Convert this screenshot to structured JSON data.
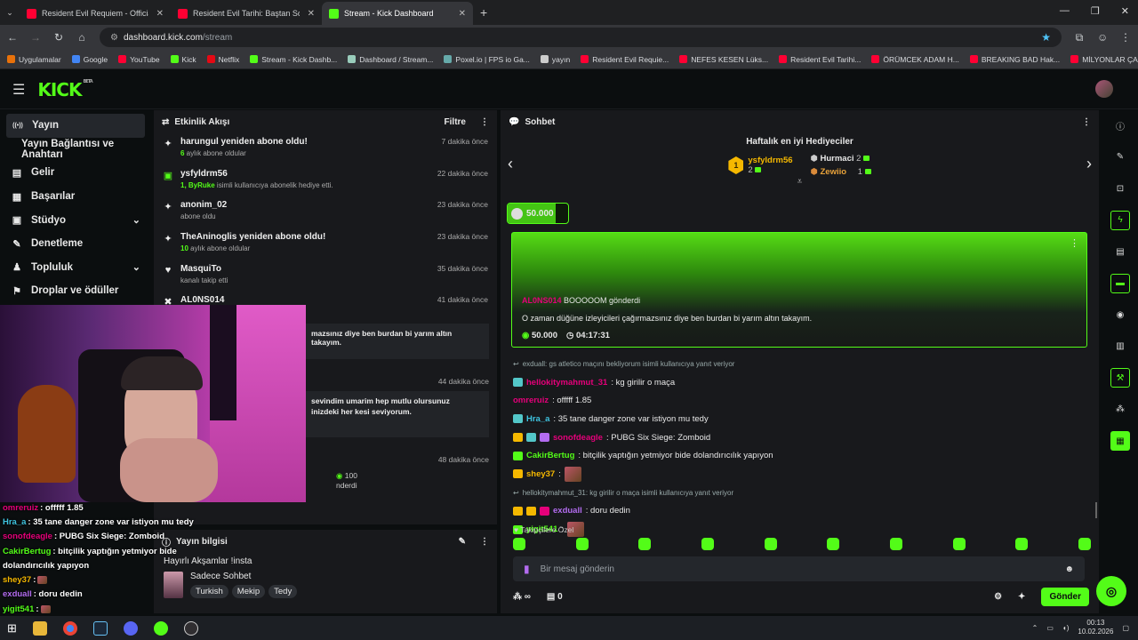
{
  "browser": {
    "tabs": [
      {
        "title": "Resident Evil Requiem - Official",
        "icon": "youtube-icon",
        "color": "#ff0033",
        "active": false
      },
      {
        "title": "Resident Evil Tarihi: Baştan Sona",
        "icon": "youtube-icon",
        "color": "#ff0033",
        "active": false
      },
      {
        "title": "Stream - Kick Dashboard",
        "icon": "kick-icon",
        "color": "#53fc18",
        "active": true
      }
    ],
    "url_host": "dashboard.kick.com",
    "url_path": "/stream",
    "bookmarks": [
      {
        "label": "Uygulamalar",
        "icon": "apps-icon",
        "color": "#e8710a"
      },
      {
        "label": "Google",
        "icon": "google-icon",
        "color": "#4285f4"
      },
      {
        "label": "YouTube",
        "icon": "youtube-icon",
        "color": "#ff0033"
      },
      {
        "label": "Kick",
        "icon": "kick-icon",
        "color": "#53fc18"
      },
      {
        "label": "Netflix",
        "icon": "netflix-icon",
        "color": "#e50914"
      },
      {
        "label": "Stream - Kick Dashb...",
        "icon": "kick-icon",
        "color": "#53fc18"
      },
      {
        "label": "Dashboard / Stream...",
        "icon": "stream-icon",
        "color": "#9cb"
      },
      {
        "label": "Poxel.io | FPS io Ga...",
        "icon": "poxel-icon",
        "color": "#6aa"
      },
      {
        "label": "yayın",
        "icon": "folder-icon",
        "color": "#ccc"
      },
      {
        "label": "Resident Evil Requie...",
        "icon": "youtube-icon",
        "color": "#ff0033"
      },
      {
        "label": "NEFES KESEN Lüks...",
        "icon": "youtube-icon",
        "color": "#ff0033"
      },
      {
        "label": "Resident Evil Tarihi...",
        "icon": "youtube-icon",
        "color": "#ff0033"
      },
      {
        "label": "ÖRÜMCEK ADAM H...",
        "icon": "youtube-icon",
        "color": "#ff0033"
      },
      {
        "label": "BREAKING BAD Hak...",
        "icon": "youtube-icon",
        "color": "#ff0033"
      },
      {
        "label": "MİLYONLAR ÇALAR...",
        "icon": "youtube-icon",
        "color": "#ff0033"
      }
    ]
  },
  "kick": {
    "logo": "KICK",
    "beta": "BETA",
    "accent": "#53fc18"
  },
  "sidebar": {
    "items": [
      {
        "label": "Yayın",
        "icon": "broadcast-icon",
        "active": true,
        "chevron": false
      },
      {
        "label": "Yayın Bağlantısı ve Anahtarı",
        "icon": "",
        "active": false,
        "chevron": false,
        "sub": true
      },
      {
        "label": "Gelir",
        "icon": "revenue-icon",
        "active": false,
        "chevron": false
      },
      {
        "label": "Başarılar",
        "icon": "achievements-icon",
        "active": false,
        "chevron": false
      },
      {
        "label": "Stüdyo",
        "icon": "studio-icon",
        "active": false,
        "chevron": true
      },
      {
        "label": "Denetleme",
        "icon": "moderation-icon",
        "active": false,
        "chevron": false
      },
      {
        "label": "Topluluk",
        "icon": "community-icon",
        "active": false,
        "chevron": true
      },
      {
        "label": "Droplar ve ödüller",
        "icon": "drops-icon",
        "active": false,
        "chevron": false
      }
    ]
  },
  "activity": {
    "title": "Etkinlik Akışı",
    "filter": "Filtre",
    "items": [
      {
        "icon": "sparkle-icon",
        "title": "harungul yeniden abone oldu!",
        "sub_num": "6",
        "sub": " aylık abone oldular",
        "time": "7 dakika önce"
      },
      {
        "icon": "gift-icon",
        "title": "ysfyldrm56",
        "sub_num": "1, ByRuke",
        "sub": " isimli kullanıcıya abonelik hediye etti.",
        "time": "22 dakika önce"
      },
      {
        "icon": "sparkle-icon",
        "title": "anonim_02",
        "sub_num": "",
        "sub": "abone oldu",
        "time": "23 dakika önce"
      },
      {
        "icon": "sparkle-icon",
        "title": "TheAninoglis yeniden abone oldu!",
        "sub_num": "10",
        "sub": " aylık abone oldular",
        "time": "23 dakika önce"
      },
      {
        "icon": "heart-icon",
        "title": "MasquiTo",
        "sub_num": "",
        "sub": "kanalı takip etti",
        "time": "35 dakika önce"
      },
      {
        "icon": "kick-coin-icon",
        "title": "AL0NS014",
        "sub_num": ", BOOOOOM",
        "sub": "",
        "time": "41 dakika önce"
      }
    ],
    "msg1": "mazsınız diye ben burdan bi yarım altın takayım.",
    "time_44": "44 dakika önce",
    "msg2_line1": "sevindim umarim hep mutlu olursunuz",
    "msg2_line2": "inizdeki her kesi seviyorum.",
    "time_48": "48 dakika önce",
    "tail_amount": "100",
    "tail_label": "nderdi"
  },
  "stream_info": {
    "title": "Yayın bilgisi",
    "stream_title": "Hayırlı Akşamlar !insta",
    "category": "Sadece Sohbet",
    "tags": [
      "Turkish",
      "Mekip",
      "Tedy"
    ]
  },
  "chat": {
    "title": "Sohbet",
    "top_gifters_title": "Haftalık en iyi Hediyeciler",
    "gifters": [
      {
        "rank": "1",
        "name": "ysfyldrm56",
        "count": "2"
      },
      {
        "rank": "2",
        "name": "Hurmaci",
        "count": "2"
      },
      {
        "rank": "3",
        "name": "Zewiio",
        "count": "1"
      }
    ],
    "kick_token_amount": "50.000",
    "kick_token_progress": 0.8,
    "gift_card": {
      "user": "AL0NS014",
      "action": "BOOOOOM gönderdi",
      "message": "O zaman düğüne izleyicileri çağırmazsınız diye ben burdan bi yarım altın takayım.",
      "amount": "50.000",
      "duration": "04:17:31"
    },
    "lines": [
      {
        "type": "reply",
        "text": "exduall: gs atletico maçını bekliyorum isimli kullanıcıya yanıt veriyor"
      },
      {
        "type": "msg",
        "user": "hellokitymahmut_31",
        "color": "#e5007a",
        "text": ": kg girilir o maça",
        "badges": [
          "#53c7c9"
        ]
      },
      {
        "type": "msg",
        "user": "omreruiz",
        "color": "#e5007a",
        "text": ": offfff 1.85",
        "badges": []
      },
      {
        "type": "msg",
        "user": "Hra_a",
        "color": "#3fc4e0",
        "text": ": 35 tane danger zone var istiyon mu tedy",
        "badges": [
          "#53c7c9"
        ]
      },
      {
        "type": "msg",
        "user": "sonofdeagle",
        "color": "#e5007a",
        "text": ": PUBG Six Siege: Zomboid",
        "badges": [
          "#f5b800",
          "#53c7c9",
          "#b36cf0"
        ]
      },
      {
        "type": "msg",
        "user": "CakirBertug",
        "color": "#53fc18",
        "text": ": bitçilik yaptığın yetmiyor bide dolandırıcılık yapıyon",
        "badges": [
          "#53fc18"
        ]
      },
      {
        "type": "msg",
        "user": "shey37",
        "color": "#f5b800",
        "text": ":",
        "badges": [
          "#f5b800"
        ],
        "emote": true
      },
      {
        "type": "reply",
        "text": "hellokitymahmut_31: kg girilir o maça isimli kullanıcıya yanıt veriyor"
      },
      {
        "type": "msg",
        "user": "exduall",
        "color": "#b36cf0",
        "text": ": doru dedin",
        "badges": [
          "#f5b800",
          "#f5b800",
          "#e5007a"
        ]
      },
      {
        "type": "msg",
        "user": "yigit541",
        "color": "#53fc18",
        "text": ":",
        "badges": [
          "#53fc18"
        ],
        "emote": true
      }
    ],
    "followers_only": "Takipçilere Özel",
    "input_placeholder": "Bir mesaj gönderin",
    "points": "0",
    "send": "Gönder"
  },
  "overlay_chat": [
    {
      "user": "omreruiz",
      "color": "#e5007a",
      "text": ": offfff 1.85"
    },
    {
      "user": "Hra_a",
      "color": "#3fc4e0",
      "text": ": 35 tane danger zone var istiyon mu tedy"
    },
    {
      "user": "sonofdeagle",
      "color": "#e5007a",
      "text": ": PUBG Six Siege: Zomboid"
    },
    {
      "user": "CakirBertug",
      "color": "#53fc18",
      "text": ": bitçilik yaptığın yetmiyor bide"
    },
    {
      "user": "",
      "color": "#fff",
      "text": "dolandırıcılık yapıyon"
    },
    {
      "user": "shey37",
      "color": "#f5b800",
      "text": ":"
    },
    {
      "user": "exduall",
      "color": "#b36cf0",
      "text": ": doru dedin"
    },
    {
      "user": "yigit541",
      "color": "#53fc18",
      "text": ":"
    }
  ],
  "taskbar": {
    "time": "00:13",
    "date": "10.02.2026"
  }
}
